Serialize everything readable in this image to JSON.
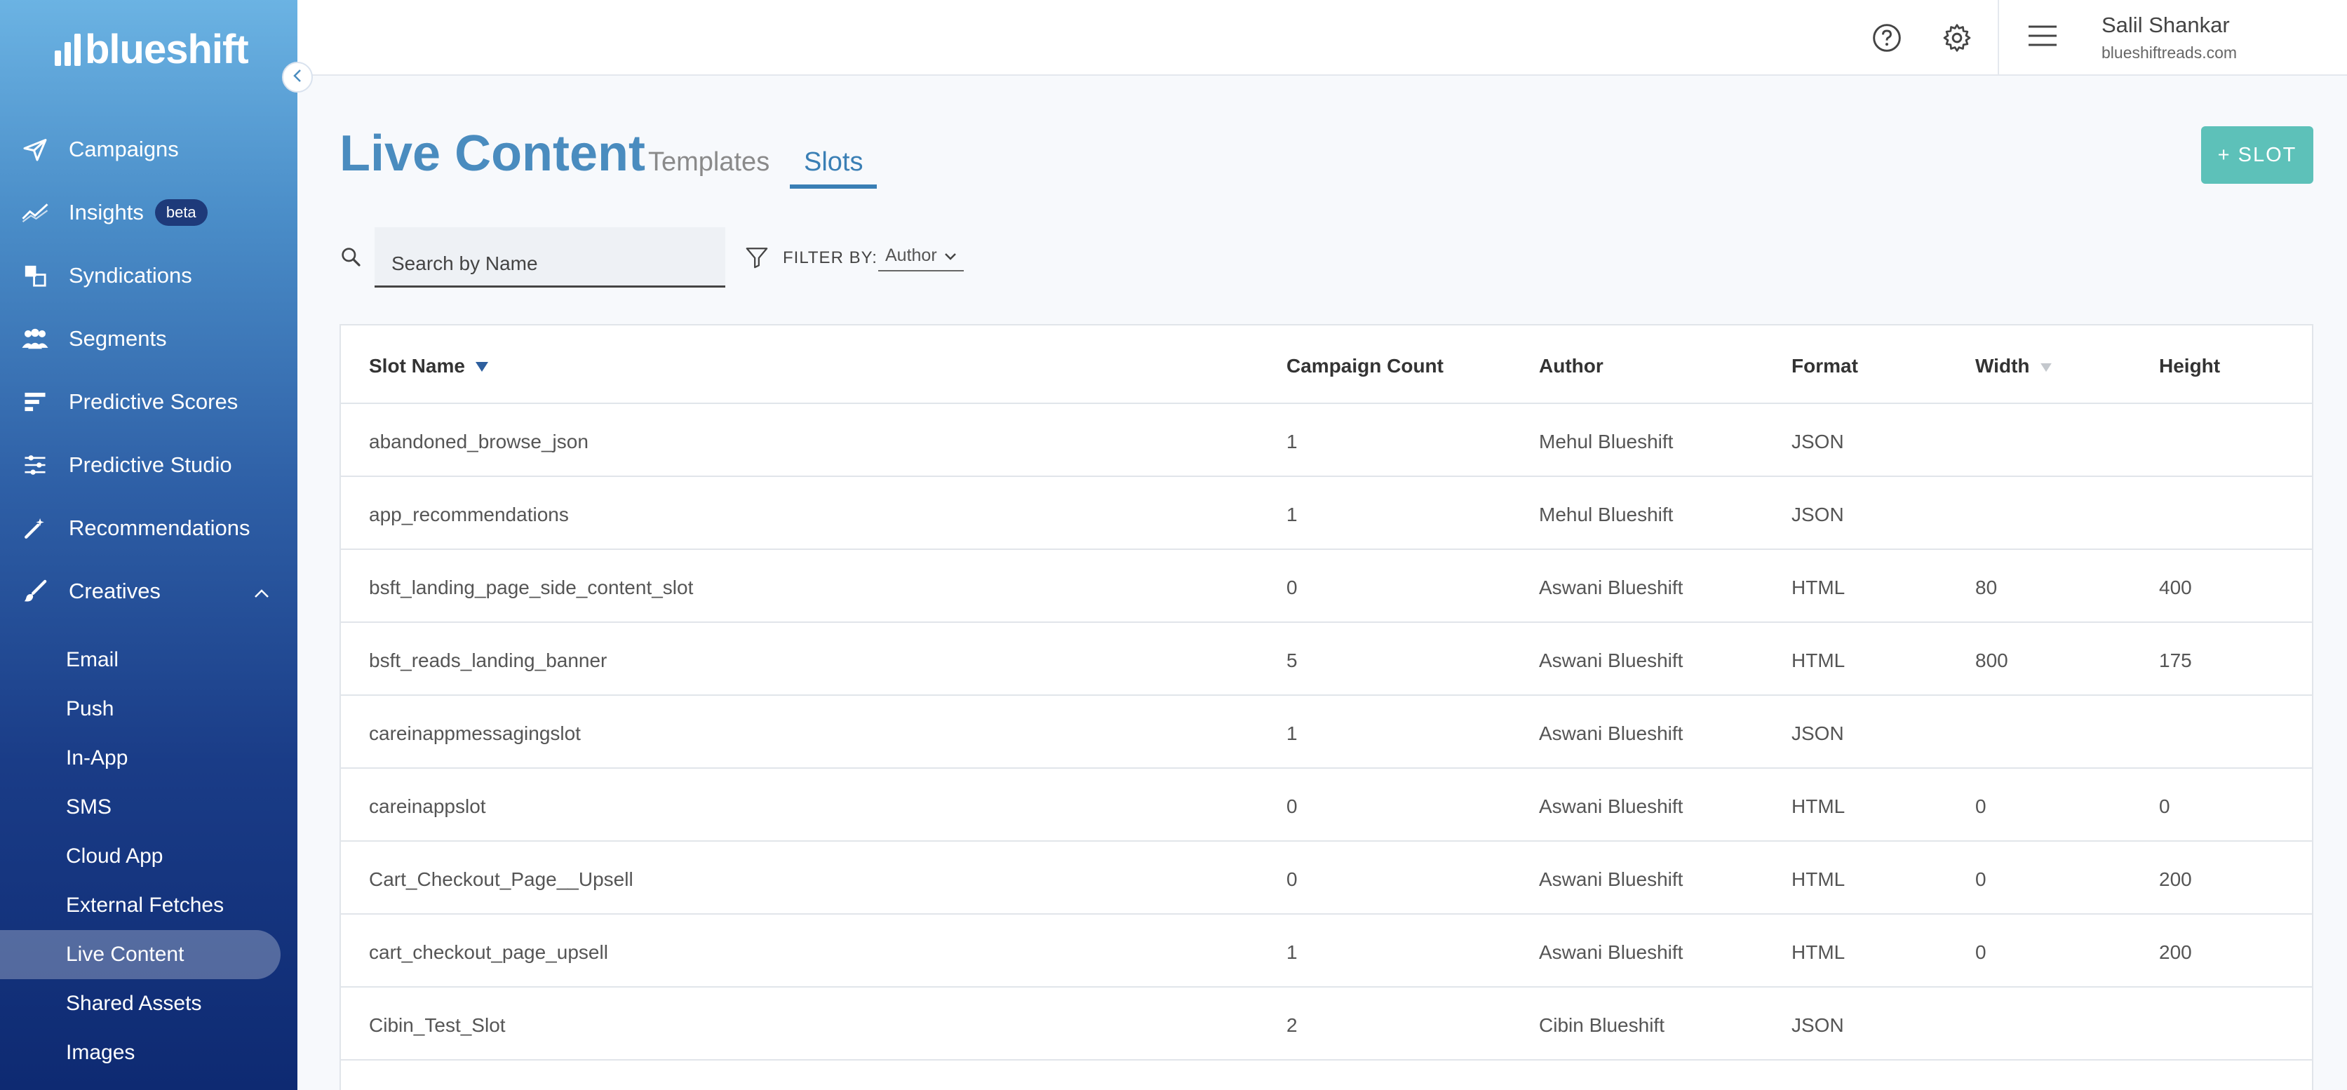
{
  "brand": {
    "logo_text": "blueshift"
  },
  "sidebar": {
    "items": [
      {
        "label": "Campaigns",
        "icon": "send-icon"
      },
      {
        "label": "Insights",
        "icon": "chart-line-icon",
        "badge": "beta"
      },
      {
        "label": "Syndications",
        "icon": "syndications-icon"
      },
      {
        "label": "Segments",
        "icon": "users-icon"
      },
      {
        "label": "Predictive Scores",
        "icon": "bars-icon"
      },
      {
        "label": "Predictive Studio",
        "icon": "sliders-icon"
      },
      {
        "label": "Recommendations",
        "icon": "magic-wand-icon"
      },
      {
        "label": "Creatives",
        "icon": "brush-icon"
      }
    ],
    "creatives_sub": [
      "Email",
      "Push",
      "In-App",
      "SMS",
      "Cloud App",
      "External Fetches",
      "Live Content",
      "Shared Assets",
      "Images"
    ],
    "active_sub": "Live Content"
  },
  "header": {
    "user_name": "Salil Shankar",
    "user_domain": "blueshiftreads.com"
  },
  "page": {
    "title": "Live Content",
    "tabs": [
      "Templates",
      "Slots"
    ],
    "active_tab": "Slots",
    "add_button": "+ SLOT"
  },
  "search": {
    "placeholder": "Search by Name",
    "value": ""
  },
  "filter": {
    "label": "FILTER BY:",
    "selected": "Author"
  },
  "table": {
    "columns": [
      "Slot Name",
      "Campaign Count",
      "Author",
      "Format",
      "Width",
      "Height"
    ],
    "rows": [
      [
        "abandoned_browse_json",
        "1",
        "Mehul Blueshift",
        "JSON",
        "",
        ""
      ],
      [
        "app_recommendations",
        "1",
        "Mehul Blueshift",
        "JSON",
        "",
        ""
      ],
      [
        "bsft_landing_page_side_content_slot",
        "0",
        "Aswani Blueshift",
        "HTML",
        "80",
        "400"
      ],
      [
        "bsft_reads_landing_banner",
        "5",
        "Aswani Blueshift",
        "HTML",
        "800",
        "175"
      ],
      [
        "careinappmessagingslot",
        "1",
        "Aswani Blueshift",
        "JSON",
        "",
        ""
      ],
      [
        "careinappslot",
        "0",
        "Aswani Blueshift",
        "HTML",
        "0",
        "0"
      ],
      [
        "Cart_Checkout_Page__Upsell",
        "0",
        "Aswani Blueshift",
        "HTML",
        "0",
        "200"
      ],
      [
        "cart_checkout_page_upsell",
        "1",
        "Aswani Blueshift",
        "HTML",
        "0",
        "200"
      ],
      [
        "Cibin_Test_Slot",
        "2",
        "Cibin Blueshift",
        "JSON",
        "",
        ""
      ]
    ]
  },
  "colors": {
    "accent": "#4a8cbf",
    "button": "#5dc1b9",
    "sidebar_top": "#6bb3e3",
    "sidebar_bottom": "#0e2a72"
  }
}
